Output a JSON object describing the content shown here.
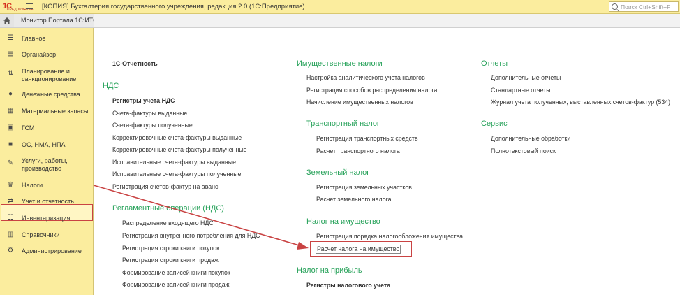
{
  "titlebar": {
    "logo": "1С",
    "logo_sub": "ПРЕДПРИЯТИЕ",
    "title": "[КОПИЯ] Бухгалтерия государственного учреждения, редакция 2.0  (1С:Предприятие)",
    "search_placeholder": "Поиск Ctrl+Shift+F"
  },
  "tabs": {
    "portal": "Монитор Портала 1С:ИТС"
  },
  "sidebar": {
    "items": [
      {
        "label": "Главное",
        "icon": "list-icon"
      },
      {
        "label": "Органайзер",
        "icon": "organizer-icon"
      },
      {
        "label": "Планирование и санкционирование",
        "icon": "planning-icon"
      },
      {
        "label": "Денежные средства",
        "icon": "money-icon"
      },
      {
        "label": "Материальные запасы",
        "icon": "materials-icon"
      },
      {
        "label": "ГСМ",
        "icon": "fuel-icon"
      },
      {
        "label": "ОС, НМА, НПА",
        "icon": "truck-icon"
      },
      {
        "label": "Услуги, работы, производство",
        "icon": "services-icon"
      },
      {
        "label": "Налоги",
        "icon": "eagle-icon"
      },
      {
        "label": "Учет и отчетность",
        "icon": "accounting-icon"
      },
      {
        "label": "Инвентаризация",
        "icon": "inventory-icon"
      },
      {
        "label": "Справочники",
        "icon": "book-icon"
      },
      {
        "label": "Администрирование",
        "icon": "gear-icon"
      }
    ]
  },
  "col1": {
    "reporting": "1С-Отчетность",
    "nds_header": "НДС",
    "nds_bold": "Регистры учета НДС",
    "nds_items": [
      "Счета-фактуры выданные",
      "Счета-фактуры полученные",
      "Корректировочные счета-фактуры выданные",
      "Корректировочные счета-фактуры полученные",
      "Исправительные счета-фактуры выданные",
      "Исправительные счета-фактуры полученные",
      "Регистрация счетов-фактур на аванс"
    ],
    "routine_header": "Регламентные операции (НДС)",
    "routine_items": [
      "Распределение входящего НДС",
      "Регистрация внутреннего потребления для НДС",
      "Регистрация строки книги покупок",
      "Регистрация строки книги продаж",
      "Формирование записей книги покупок",
      "Формирование записей книги продаж"
    ]
  },
  "col2": {
    "property_header": "Имущественные налоги",
    "property_items": [
      "Настройка аналитического учета налогов",
      "Регистрация способов распределения налога",
      "Начисление имущественных налогов"
    ],
    "transport_header": "Транспортный налог",
    "transport_items": [
      "Регистрация транспортных средств",
      "Расчет транспортного налога"
    ],
    "land_header": "Земельный налог",
    "land_items": [
      "Регистрация земельных участков",
      "Расчет земельного налога"
    ],
    "estate_header": "Налог на имущество",
    "estate_items": [
      "Регистрация порядка налогообложения имущества",
      "Расчет налога на имущество"
    ],
    "profit_header": "Налог на прибыль",
    "profit_bold": "Регистры налогового учета"
  },
  "col3": {
    "reports_header": "Отчеты",
    "reports_items": [
      "Дополнительные отчеты",
      "Стандартные отчеты",
      "Журнал учета полученных, выставленных счетов-фактур (534)"
    ],
    "service_header": "Сервис",
    "service_items": [
      "Дополнительные обработки",
      "Полнотекстовый поиск"
    ]
  },
  "colors": {
    "accent_yellow": "#fbed9e",
    "header_green": "#27a25a",
    "highlight_red": "#c94343"
  }
}
